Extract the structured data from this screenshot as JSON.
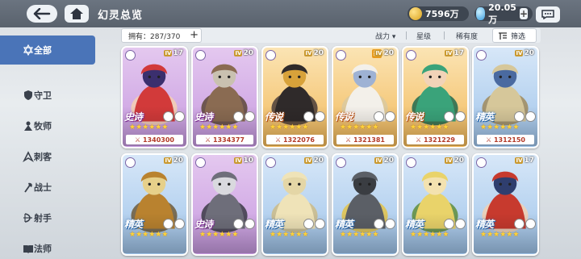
{
  "header": {
    "title": "幻灵总览",
    "gold": "7596万",
    "gems": "20.05万",
    "plus": "+"
  },
  "sidebar": {
    "items": [
      {
        "label": "全部",
        "icon": "star-of-david-icon",
        "active": true
      },
      {
        "label": "守卫",
        "icon": "shield-icon",
        "active": false
      },
      {
        "label": "牧师",
        "icon": "priest-icon",
        "active": false
      },
      {
        "label": "刺客",
        "icon": "dagger-icon",
        "active": false
      },
      {
        "label": "战士",
        "icon": "axe-icon",
        "active": false
      },
      {
        "label": "射手",
        "icon": "bow-icon",
        "active": false
      },
      {
        "label": "法师",
        "icon": "spellbook-icon",
        "active": false
      }
    ]
  },
  "filterbar": {
    "owned": "拥有：287/370",
    "plus": "+",
    "sort_power": "战力 ▾",
    "sort_star": "星级",
    "sort_rarity": "稀有度",
    "filter": "筛选"
  },
  "cards": [
    {
      "rarity": "史诗",
      "tier": "epic",
      "level": "17",
      "power": "1340300",
      "stars": "★★★★★★",
      "new": false,
      "colors": [
        "#d23a3a",
        "#f4d0b2",
        "#3b2f6e"
      ]
    },
    {
      "rarity": "史诗",
      "tier": "epic",
      "level": "20",
      "power": "1334377",
      "stars": "★★★★★★",
      "new": false,
      "colors": [
        "#8a6b52",
        "#5c4636",
        "#c9c1b0"
      ]
    },
    {
      "rarity": "传说",
      "tier": "legend",
      "level": "20",
      "power": "1322076",
      "stars": "★★★★★★",
      "new": false,
      "colors": [
        "#2f2a2a",
        "#4a3d3a",
        "#d8a23a"
      ]
    },
    {
      "rarity": "传说",
      "tier": "legend",
      "level": "20",
      "power": "1321381",
      "stars": "★★★★★★",
      "new": true,
      "new_label": "新",
      "colors": [
        "#f3f0ea",
        "#d9c9a0",
        "#9eb2d4"
      ]
    },
    {
      "rarity": "传说",
      "tier": "legend",
      "level": "17",
      "power": "1321229",
      "stars": "★★★★★★",
      "new": false,
      "colors": [
        "#3aa37a",
        "#1f6a4f",
        "#f2d3b8"
      ]
    },
    {
      "rarity": "精英",
      "tier": "elite",
      "level": "20",
      "power": "1312150",
      "stars": "★★★★★★",
      "new": false,
      "colors": [
        "#d6c79a",
        "#a08a5a",
        "#4a6aa0"
      ]
    },
    {
      "rarity": "精英",
      "tier": "elite",
      "level": "20",
      "power": "",
      "stars": "★★★★★★",
      "new": false,
      "colors": [
        "#b9822f",
        "#6d5a3a",
        "#e6d08a"
      ]
    },
    {
      "rarity": "史诗",
      "tier": "epic",
      "level": "10",
      "power": "",
      "stars": "★★★★★★",
      "new": false,
      "colors": [
        "#6e6e7a",
        "#3a3a44",
        "#d9d9de"
      ]
    },
    {
      "rarity": "精英",
      "tier": "elite",
      "level": "20",
      "power": "",
      "stars": "★★★★★★",
      "new": false,
      "colors": [
        "#efe3b8",
        "#cdbb86",
        "#e4d6a6"
      ]
    },
    {
      "rarity": "精英",
      "tier": "elite",
      "level": "20",
      "power": "",
      "stars": "★★★★★★",
      "new": false,
      "colors": [
        "#5b5f66",
        "#e3c348",
        "#3a3d42"
      ]
    },
    {
      "rarity": "精英",
      "tier": "elite",
      "level": "20",
      "power": "",
      "stars": "★★★★★★",
      "new": false,
      "colors": [
        "#e9d36a",
        "#5f8d3a",
        "#f3e2b0"
      ]
    },
    {
      "rarity": "精英",
      "tier": "elite",
      "level": "17",
      "power": "",
      "stars": "★★★★★★",
      "new": false,
      "colors": [
        "#c73a2e",
        "#f2cfb0",
        "#2f3e6e"
      ]
    }
  ],
  "colors": {
    "active_tab": "#4a74b8",
    "topbar": "#5f6874",
    "power_text": "#b33a28"
  }
}
